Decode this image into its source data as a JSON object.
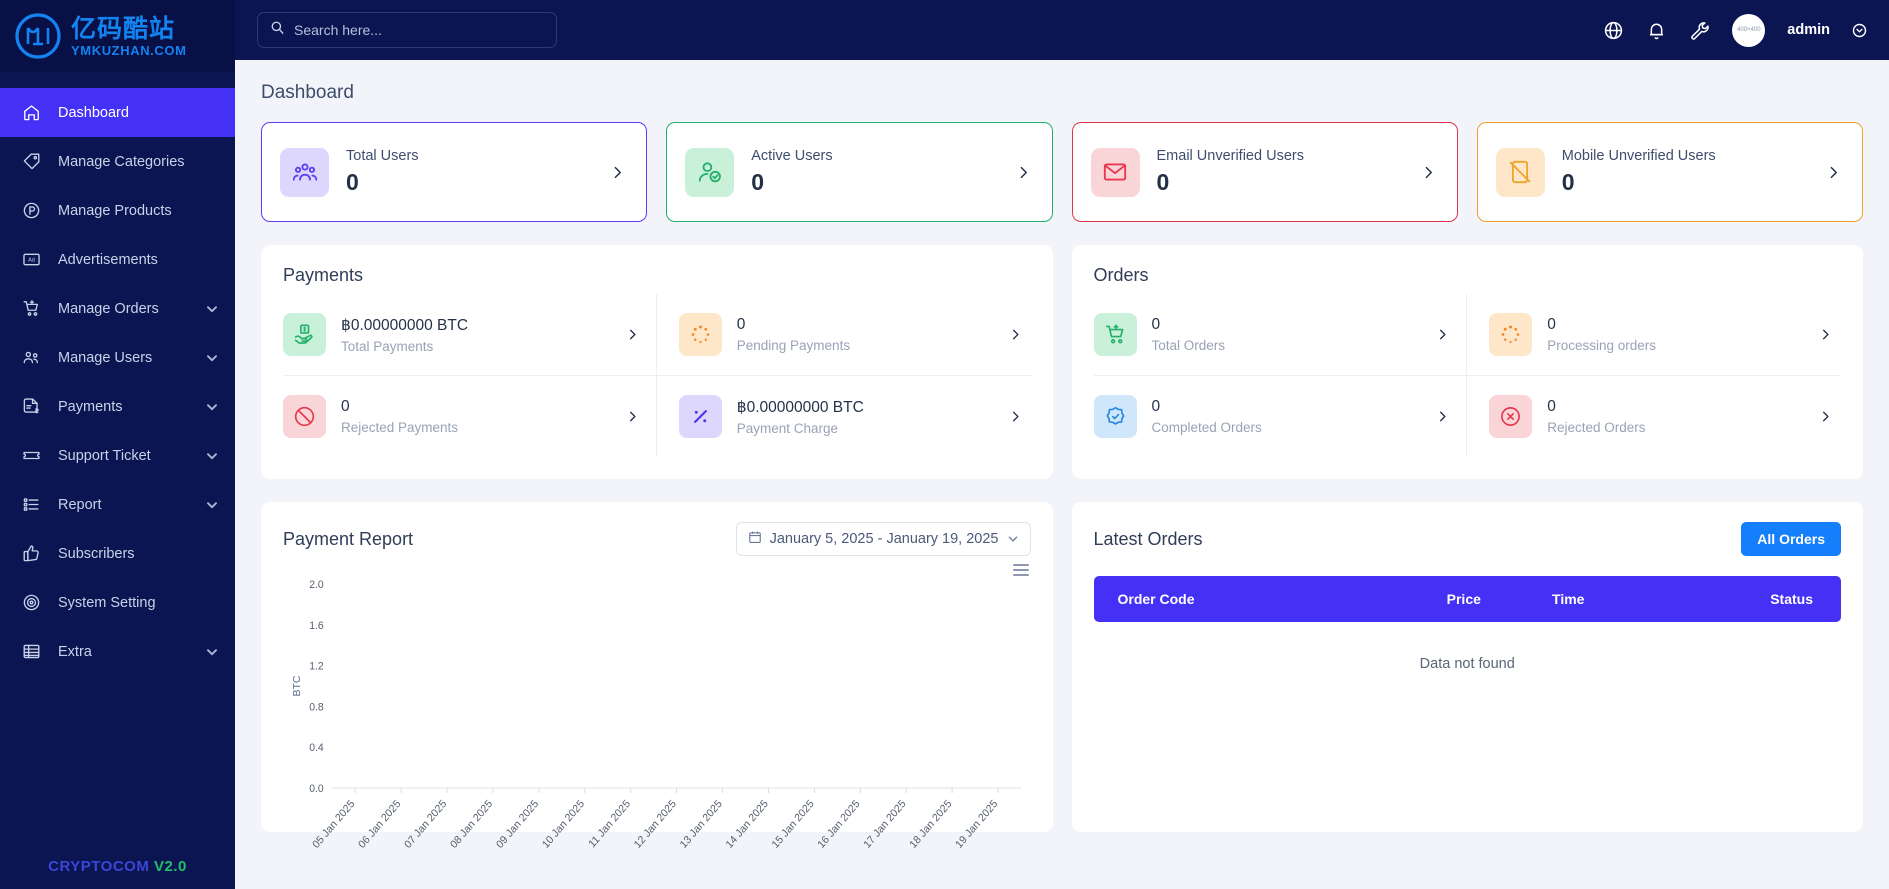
{
  "brand": {
    "logo_cn": "亿码酷站",
    "logo_en": "YMKUZHAN.COM",
    "footer_name": "CRYPTOCOM",
    "footer_version": "V2.0"
  },
  "search": {
    "placeholder": "Search here...",
    "value": ""
  },
  "topbar": {
    "globe_icon": "globe-icon",
    "bell_icon": "bell-icon",
    "wrench_icon": "wrench-icon",
    "avatar_text": "400×400",
    "user_name": "admin"
  },
  "sidebar": {
    "items": [
      {
        "label": "Dashboard",
        "icon": "home-icon",
        "active": true,
        "caret": false
      },
      {
        "label": "Manage Categories",
        "icon": "tag-icon",
        "active": false,
        "caret": false
      },
      {
        "label": "Manage Products",
        "icon": "product-icon",
        "active": false,
        "caret": false
      },
      {
        "label": "Advertisements",
        "icon": "ad-icon",
        "active": false,
        "caret": false
      },
      {
        "label": "Manage Orders",
        "icon": "cart-icon",
        "active": false,
        "caret": true
      },
      {
        "label": "Manage Users",
        "icon": "users-icon",
        "active": false,
        "caret": true
      },
      {
        "label": "Payments",
        "icon": "invoice-icon",
        "active": false,
        "caret": true
      },
      {
        "label": "Support Ticket",
        "icon": "ticket-icon",
        "active": false,
        "caret": true
      },
      {
        "label": "Report",
        "icon": "list-icon",
        "active": false,
        "caret": true
      },
      {
        "label": "Subscribers",
        "icon": "thumbs-up-icon",
        "active": false,
        "caret": false
      },
      {
        "label": "System Setting",
        "icon": "gear-icon",
        "active": false,
        "caret": false
      },
      {
        "label": "Extra",
        "icon": "table-icon",
        "active": false,
        "caret": true
      }
    ]
  },
  "page": {
    "title": "Dashboard"
  },
  "stats": [
    {
      "label": "Total Users",
      "value": "0",
      "icon": "users-group-icon",
      "border": "#5b3df2",
      "bg": "#ddd7fd",
      "fg": "#5b3df2"
    },
    {
      "label": "Active Users",
      "value": "0",
      "icon": "user-check-icon",
      "border": "#23b06b",
      "bg": "#c9f0d9",
      "fg": "#23b06b"
    },
    {
      "label": "Email Unverified Users",
      "value": "0",
      "icon": "envelope-icon",
      "border": "#e0364c",
      "bg": "#fad5d8",
      "fg": "#e5384c"
    },
    {
      "label": "Mobile Unverified Users",
      "value": "0",
      "icon": "mobile-off-icon",
      "border": "#f0a32a",
      "bg": "#fde7c8",
      "fg": "#f0a32a"
    }
  ],
  "payments": {
    "title": "Payments",
    "cells": [
      {
        "value": "฿0.00000000 BTC",
        "label": "Total Payments",
        "icon": "hand-cash-icon",
        "bg": "#c9f0d9",
        "fg": "#23b06b"
      },
      {
        "value": "0",
        "label": "Pending Payments",
        "icon": "spinner-icon",
        "bg": "#fde7c8",
        "fg": "#f0862a"
      },
      {
        "value": "0",
        "label": "Rejected Payments",
        "icon": "ban-icon",
        "bg": "#fad5d8",
        "fg": "#e5384c"
      },
      {
        "value": "฿0.00000000 BTC",
        "label": "Payment Charge",
        "icon": "percent-icon",
        "bg": "#ddd7fd",
        "fg": "#4a36e8"
      }
    ]
  },
  "orders": {
    "title": "Orders",
    "cells": [
      {
        "value": "0",
        "label": "Total Orders",
        "icon": "cart-icon",
        "bg": "#c9f0d9",
        "fg": "#23b06b"
      },
      {
        "value": "0",
        "label": "Processing orders",
        "icon": "spinner-icon",
        "bg": "#fde7c8",
        "fg": "#f0862a"
      },
      {
        "value": "0",
        "label": "Completed Orders",
        "icon": "check-badge-icon",
        "bg": "#cfe6fb",
        "fg": "#2387e0"
      },
      {
        "value": "0",
        "label": "Rejected Orders",
        "icon": "x-circle-icon",
        "bg": "#fad5d8",
        "fg": "#e5384c"
      }
    ]
  },
  "payment_report": {
    "title": "Payment Report",
    "date_range": "January 5, 2025 - January 19, 2025",
    "calendar_icon": "calendar-icon",
    "menu_icon": "hamburger-menu-icon"
  },
  "latest_orders": {
    "title": "Latest Orders",
    "all_orders_label": "All Orders",
    "columns": [
      "Order Code",
      "Price",
      "Time",
      "Status"
    ],
    "rows": [],
    "empty_text": "Data not found"
  },
  "chart_data": {
    "type": "line",
    "title": "Payment Report",
    "xlabel": "",
    "ylabel": "BTC",
    "ylim": [
      0,
      2
    ],
    "yticks": [
      "0.0",
      "0.4",
      "0.8",
      "1.2",
      "1.6",
      "2.0"
    ],
    "grid": false,
    "categories": [
      "05 Jan 2025",
      "06 Jan 2025",
      "07 Jan 2025",
      "08 Jan 2025",
      "09 Jan 2025",
      "10 Jan 2025",
      "11 Jan 2025",
      "12 Jan 2025",
      "13 Jan 2025",
      "14 Jan 2025",
      "15 Jan 2025",
      "16 Jan 2025",
      "17 Jan 2025",
      "18 Jan 2025",
      "19 Jan 2025"
    ],
    "series": [
      {
        "name": "BTC",
        "values": [
          0,
          0,
          0,
          0,
          0,
          0,
          0,
          0,
          0,
          0,
          0,
          0,
          0,
          0,
          0
        ]
      }
    ]
  }
}
